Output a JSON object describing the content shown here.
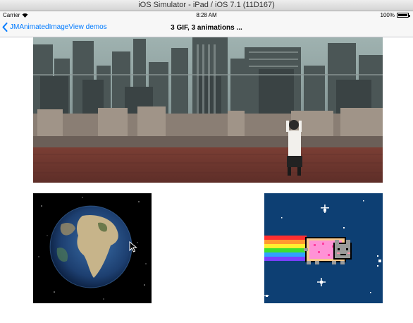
{
  "window": {
    "title": "iOS Simulator - iPad / iOS 7.1 (11D167)"
  },
  "status_bar": {
    "carrier": "Carrier",
    "time": "8:28 AM",
    "battery": "100%"
  },
  "nav_bar": {
    "back_label": "JMAnimatedImageView demos",
    "title": "3 GIF, 3 animations ..."
  },
  "icons": {
    "wifi": "wifi-icon",
    "battery": "battery-icon",
    "back": "chevron-left-icon",
    "cursor": "mouse-pointer-icon"
  },
  "colors": {
    "accent": "#007aff",
    "bar_background": "#f7f7f7",
    "nyan_background": "#0d3f73"
  }
}
